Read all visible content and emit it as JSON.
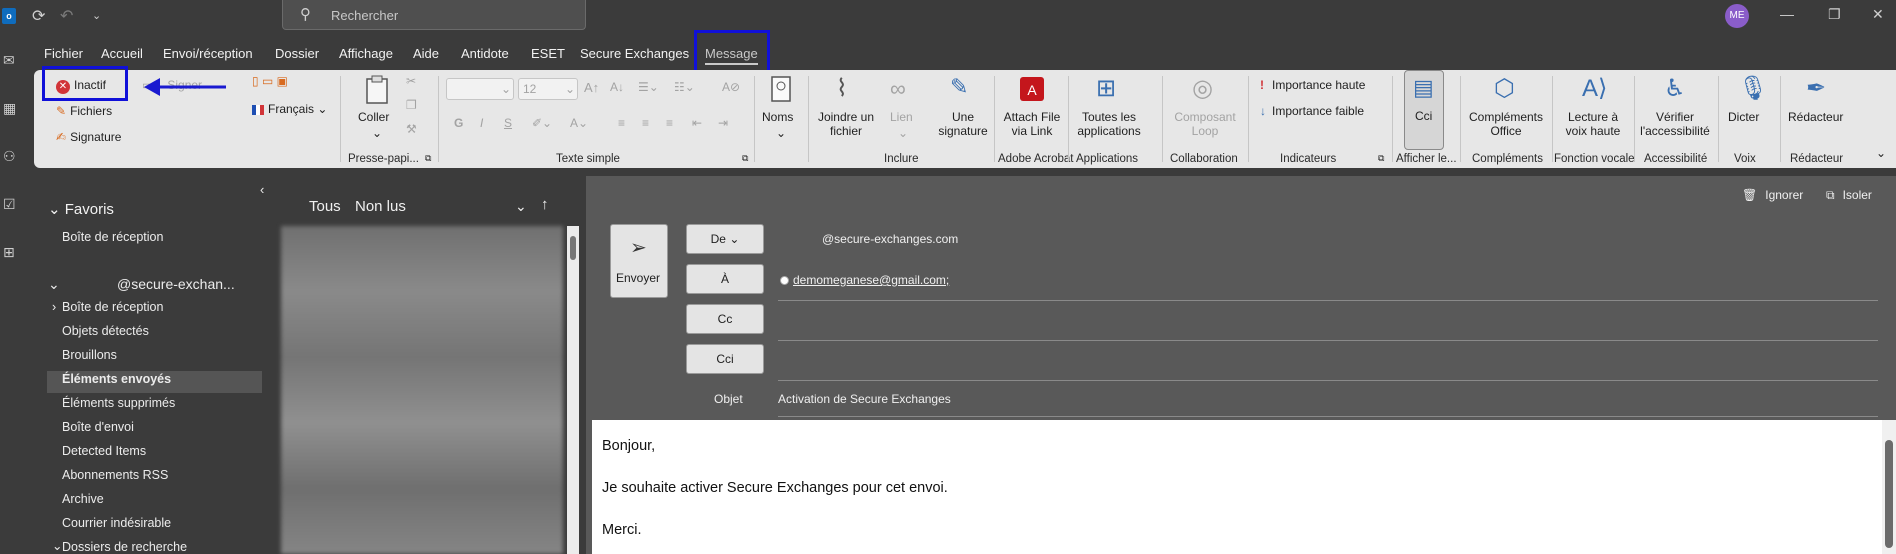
{
  "titlebar": {
    "app_icon_letter": "o",
    "search_placeholder": "Rechercher",
    "avatar_initials": "ME"
  },
  "menu": {
    "items": [
      "Fichier",
      "Accueil",
      "Envoi/réception",
      "Dossier",
      "Affichage",
      "Aide",
      "Antidote",
      "ESET",
      "Secure Exchanges",
      "Message"
    ],
    "active": "Message"
  },
  "ribbon": {
    "secure_buttons": {
      "inactif": "Inactif",
      "fichiers": "Fichiers",
      "signature": "Signature",
      "signer": "Signer"
    },
    "language": "Français",
    "paste": "Coller",
    "font_size": "12",
    "names": "Noms",
    "attach": "Joindre un fichier",
    "link": "Lien",
    "signature_btn": "Une signature",
    "attach_link": "Attach File via Link",
    "all_apps": "Toutes les applications",
    "loop": "Composant Loop",
    "importance_high": "Importance haute",
    "importance_low": "Importance faible",
    "cci": "Cci",
    "office_addins": "Compléments Office",
    "read_aloud": "Lecture à voix haute",
    "accessibility_check": "Vérifier l'accessibilité",
    "dictate": "Dicter",
    "editor": "Rédacteur",
    "groups": {
      "clipboard": "Presse-papi...",
      "basic_text": "Texte simple",
      "include": "Inclure",
      "adobe": "Adobe Acrobat",
      "applications": "Applications",
      "collaboration": "Collaboration",
      "indicators": "Indicateurs",
      "show": "Afficher le...",
      "addins": "Compléments",
      "voice_function": "Fonction vocale",
      "accessibility": "Accessibilité",
      "voice": "Voix",
      "editor": "Rédacteur"
    }
  },
  "folders": {
    "favorites_header": "Favoris",
    "favorites": [
      "Boîte de réception"
    ],
    "account": "@secure-exchan...",
    "items": [
      "Boîte de réception",
      "Objets détectés",
      "Brouillons",
      "Éléments envoyés",
      "Éléments supprimés",
      "Boîte d'envoi",
      "Detected Items",
      "Abonnements RSS",
      "Archive",
      "Courrier indésirable",
      "Dossiers de recherche"
    ],
    "selected": "Éléments envoyés"
  },
  "message_list": {
    "filter_all": "Tous",
    "filter_unread": "Non lus"
  },
  "compose": {
    "send": "Envoyer",
    "ignore": "Ignorer",
    "isolate": "Isoler",
    "from_label": "De",
    "from_value": "@secure-exchanges.com",
    "to_label": "À",
    "to_value": "demomeganese@gmail.com;",
    "cc_label": "Cc",
    "bcc_label": "Cci",
    "subject_label": "Objet",
    "subject_value": "Activation de Secure Exchanges",
    "body": [
      "Bonjour,",
      "Je souhaite activer Secure Exchanges pour cet envoi.",
      "Merci."
    ]
  },
  "colors": {
    "highlight": "#1010d8",
    "arrow": "#1a1ad0",
    "inactive_red": "#d13438",
    "accent": "#0f6cbd"
  }
}
